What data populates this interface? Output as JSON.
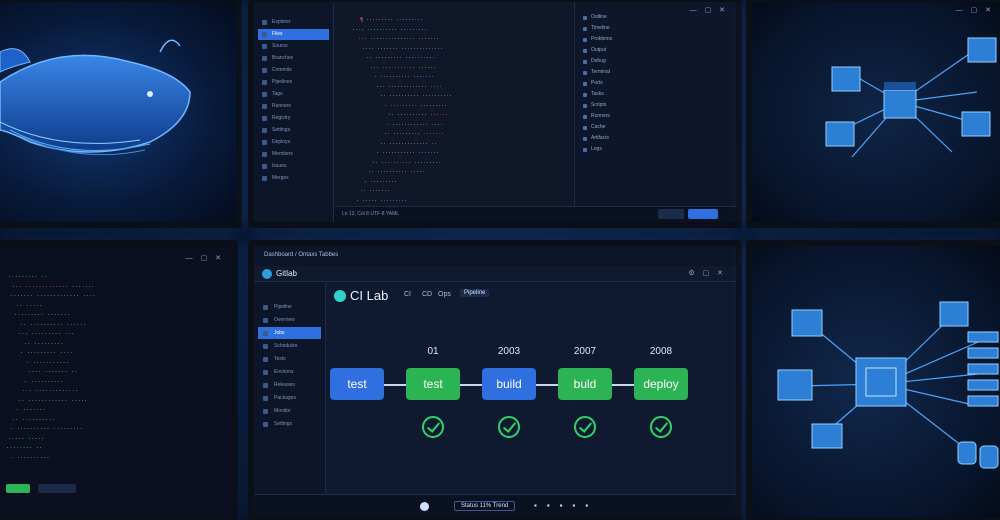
{
  "gitlab": {
    "header_title": "Gitlab",
    "header_subtitle": "Dashboard / Ontaxs Tabbes",
    "logo_text": "CI Lab",
    "nav_items": [
      "CI",
      "CD",
      "Ops"
    ],
    "nav_button": "Pipeline",
    "sidebar_items": [
      "Pipeline",
      "Overview",
      "Jobs",
      "Schedules",
      "Tests",
      "Environs",
      "Releases",
      "Packages",
      "Monitor",
      "Settings"
    ],
    "stages": [
      {
        "label": "test",
        "number": "",
        "color": "#2f6fe0",
        "status": ""
      },
      {
        "label": "test",
        "number": "01",
        "color": "#2bb354",
        "status": "passed"
      },
      {
        "label": "build",
        "number": "2003",
        "color": "#2f6fe0",
        "status": "passed"
      },
      {
        "label": "buld",
        "number": "2007",
        "color": "#2bb354",
        "status": "passed"
      },
      {
        "label": "deploy",
        "number": "2008",
        "color": "#2bb354",
        "status": "passed"
      }
    ],
    "bottom_bar_text": "Status 11% Trend"
  },
  "editor": {
    "sidebar_items": [
      "Explorer",
      "Files",
      "Source",
      "Branches",
      "Commits",
      "Pipelines",
      "Tags",
      "Runners",
      "Registry",
      "Settings",
      "Deploys",
      "Members",
      "Issues",
      "Merges"
    ],
    "right_panel_rows": [
      "Outline",
      "Timeline",
      "Problems",
      "Output",
      "Debug",
      "Terminal",
      "Ports",
      "Tasks",
      "Scripts",
      "Runners",
      "Cache",
      "Artifacts",
      "Logs"
    ],
    "status_text": "Ln 12, Col 8   UTF-8   YAML"
  },
  "colors": {
    "accent": "#2f6fe0",
    "success": "#2bb354",
    "check": "#2fd36a"
  }
}
